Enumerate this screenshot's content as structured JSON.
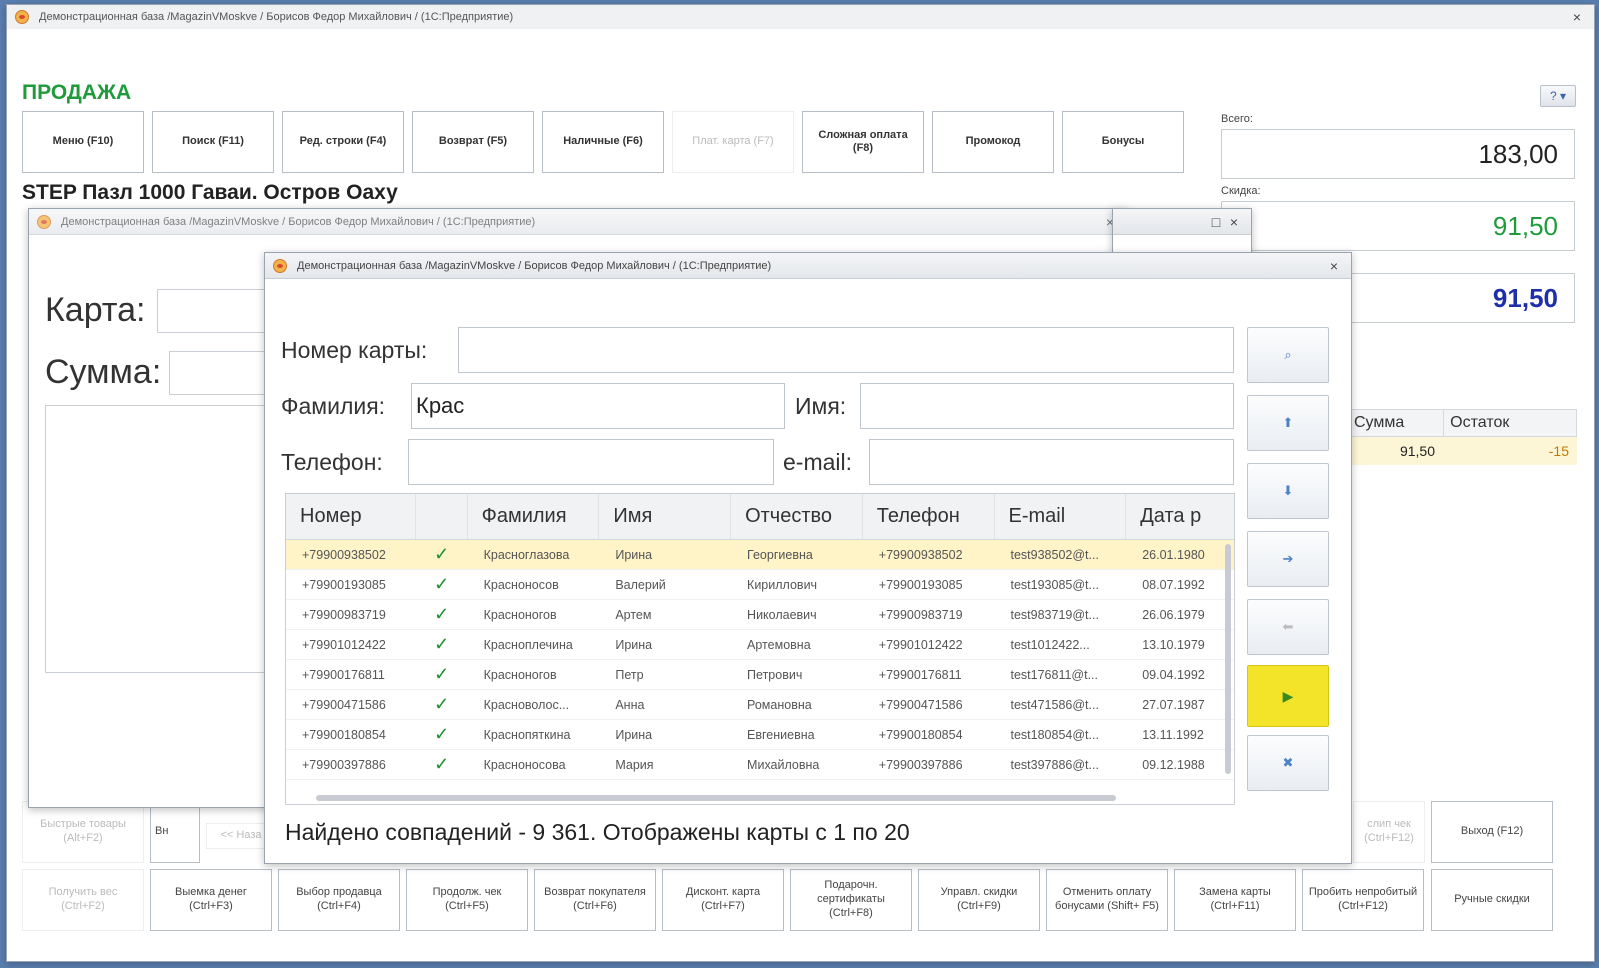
{
  "main": {
    "title": "Демонстрационная база /MagazinVMoskve / Борисов Федор Михайлович / (1С:Предприятие)",
    "page_title": "ПРОДАЖА",
    "help_label": "? ▾",
    "toolbar": [
      "Меню (F10)",
      "Поиск (F11)",
      "Ред. строки (F4)",
      "Возврат (F5)",
      "Наличные (F6)",
      "Плат. карта (F7)",
      "Сложная оплата (F8)",
      "Промокод",
      "Бонусы"
    ],
    "product_name": "STEP Пазл 1000 Гаваи. Остров Оаху",
    "totals": {
      "total_label": "Всего:",
      "total_value": "183,00",
      "discount_label": "Скидка:",
      "discount_value": "91,50",
      "due_value": "91,50"
    },
    "grid": {
      "col_sum": "Сумма",
      "col_rest": "Остаток",
      "row_sum": "91,50",
      "row_rest": "-15"
    },
    "bottom_row1": {
      "quick_goods": "Быстрые товары (Alt+F2)",
      "vn": "Вн",
      "back_btn": "<< Наза",
      "slip": "слип чек (Ctrl+F12)",
      "exit": "Выход (F12)"
    },
    "bottom_row2": [
      "Получить вес (Ctrl+F2)",
      "Выемка денег (Ctrl+F3)",
      "Выбор продавца (Ctrl+F4)",
      "Продолж. чек (Ctrl+F5)",
      "Возврат покупателя (Ctrl+F6)",
      "Дисконт. карта (Ctrl+F7)",
      "Подарочн. сертификаты (Ctrl+F8)",
      "Управл. скидки (Ctrl+F9)",
      "Отменить оплату бонусами (Shift+ F5)",
      "Замена карты (Ctrl+F11)",
      "Пробить непробитый (Ctrl+F12)",
      "Ручные скидки"
    ]
  },
  "card_window": {
    "title": "Демонстрационная база /MagazinVMoskve / Борисов Федор Михайлович / (1С:Предприятие)",
    "card_label": "Карта:",
    "sum_label": "Сумма:"
  },
  "dialog": {
    "title": "Демонстрационная база /MagazinVMoskve / Борисов Федор Михайлович / (1С:Предприятие)",
    "card_number_label": "Номер карты:",
    "card_number_value": "",
    "surname_label": "Фамилия:",
    "surname_value": "Крас",
    "name_label": "Имя:",
    "name_value": "",
    "phone_label": "Телефон:",
    "phone_value": "",
    "email_label": "e-mail:",
    "email_value": "",
    "columns": [
      "Номер",
      "",
      "Фамилия",
      "Имя",
      "Отчество",
      "Телефон",
      "E-mail",
      "Дата р"
    ],
    "rows": [
      [
        "+79900938502",
        "✓",
        "Красноглазова",
        "Ирина",
        "Георгиевна",
        "+79900938502",
        "test938502@t...",
        "26.01.1980"
      ],
      [
        "+79900193085",
        "✓",
        "Красноносов",
        "Валерий",
        "Кириллович",
        "+79900193085",
        "test193085@t...",
        "08.07.1992"
      ],
      [
        "+79900983719",
        "✓",
        "Красноногов",
        "Артем",
        "Николаевич",
        "+79900983719",
        "test983719@t...",
        "26.06.1979"
      ],
      [
        "+79901012422",
        "✓",
        "Красноплечина",
        "Ирина",
        "Артемовна",
        "+79901012422",
        "test1012422...",
        "13.10.1979"
      ],
      [
        "+79900176811",
        "✓",
        "Красноногов",
        "Петр",
        "Петрович",
        "+79900176811",
        "test176811@t...",
        "09.04.1992"
      ],
      [
        "+79900471586",
        "✓",
        "Красноволос...",
        "Анна",
        "Романовна",
        "+79900471586",
        "test471586@t...",
        "27.07.1987"
      ],
      [
        "+79900180854",
        "✓",
        "Краснопяткина",
        "Ирина",
        "Евгениевна",
        "+79900180854",
        "test180854@t...",
        "13.11.1992"
      ],
      [
        "+79900397886",
        "✓",
        "Красноносова",
        "Мария",
        "Михайловна",
        "+79900397886",
        "test397886@t...",
        "09.12.1988"
      ]
    ],
    "found_text": "Найдено совпадений - 9 361. Отображены карты с 1 по 20"
  },
  "icons": {
    "close": "×",
    "maximize": "□",
    "search": "⌕",
    "up": "⬆",
    "down": "⬇",
    "right": "➔",
    "left": "⬅",
    "play": "▶",
    "cancel": "✖"
  },
  "colors": {
    "page_title": "#1f9b3b",
    "discount": "#1f9b3b",
    "due": "#1f2fa8",
    "primary_button": "#f3e42a",
    "check": "#1e8f2d"
  }
}
